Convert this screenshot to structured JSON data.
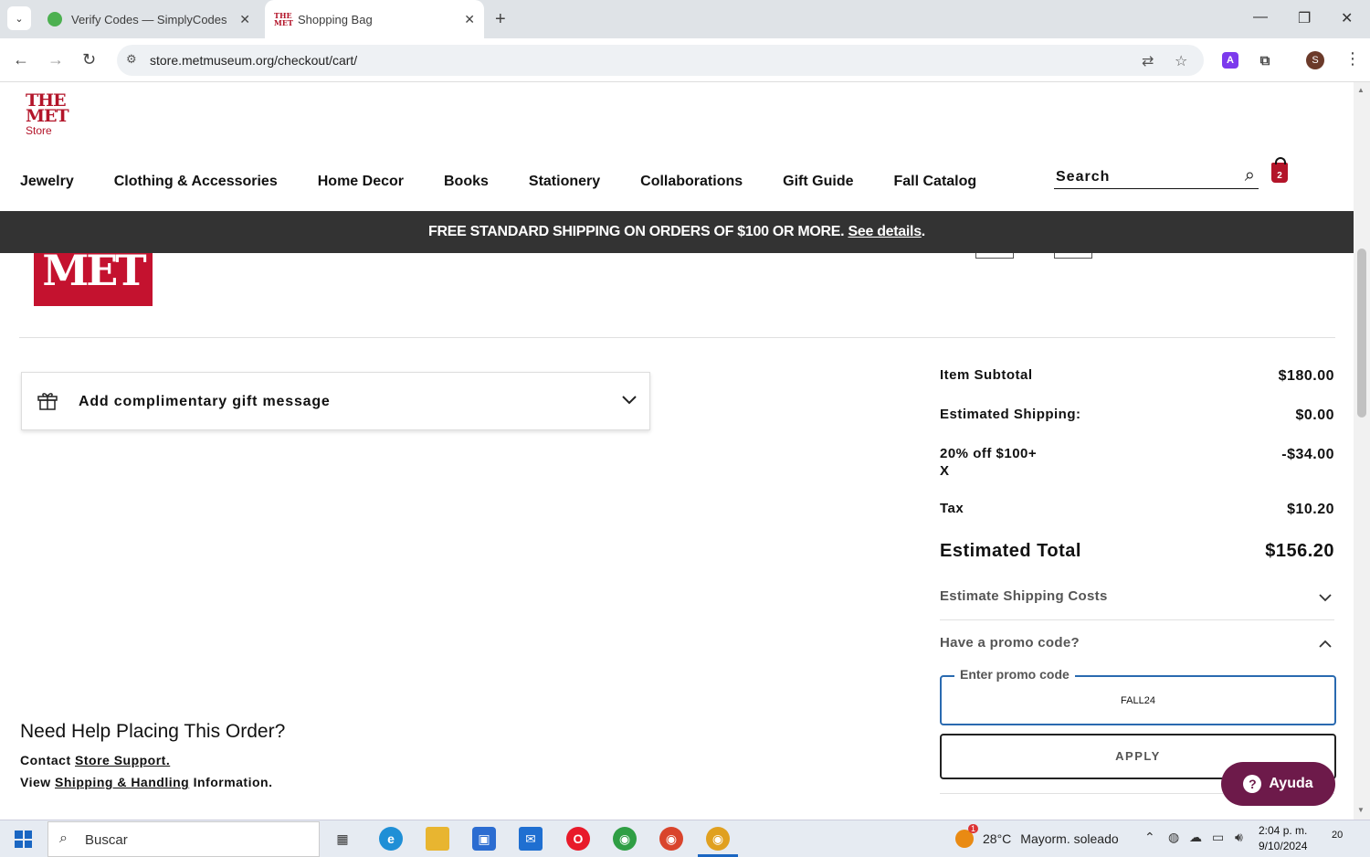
{
  "browser": {
    "tabs": [
      {
        "title": "Verify Codes — SimplyCodes",
        "active": false
      },
      {
        "title": "Shopping Bag",
        "active": true
      }
    ],
    "url": "store.metmuseum.org/checkout/cart/",
    "profile_initial": "S",
    "extension_label": "A"
  },
  "site": {
    "logo": {
      "line1": "THE",
      "line2": "MET",
      "line3": "Store"
    },
    "nav": [
      "Jewelry",
      "Clothing & Accessories",
      "Home Decor",
      "Books",
      "Stationery",
      "Collaborations",
      "Gift Guide",
      "Fall Catalog"
    ],
    "search_placeholder": "Search",
    "bag_count": "2",
    "banner": {
      "text": "FREE STANDARD SHIPPING ON ORDERS OF $100 OR MORE.",
      "link": "See details",
      "suffix": "."
    },
    "product_thumb_text": "MET"
  },
  "gift": {
    "label": "Add complimentary gift message"
  },
  "summary": {
    "rows": [
      {
        "label": "Item Subtotal",
        "value": "$180.00"
      },
      {
        "label": "Estimated Shipping:",
        "value": "$0.00"
      },
      {
        "label": "20% off $100+",
        "sub": "X",
        "value": "-$34.00"
      },
      {
        "label": "Tax",
        "value": "$10.20"
      }
    ],
    "total_label": "Estimated Total",
    "total_value": "$156.20",
    "shipping_estimate_label": "Estimate Shipping Costs",
    "promo_label": "Have a promo code?",
    "promo_field_label": "Enter promo code",
    "promo_value": "FALL24",
    "apply_label": "APPLY"
  },
  "help": {
    "title": "Need Help Placing This Order?",
    "contact_prefix": "Contact",
    "contact_link": "Store Support.",
    "view_prefix": "View",
    "view_link": "Shipping & Handling",
    "view_suffix": "Information."
  },
  "chat": {
    "label": "Ayuda"
  },
  "taskbar": {
    "search_placeholder": "Buscar",
    "weather_temp": "28°C",
    "weather_text": "Mayorm. soleado",
    "weather_alert": "1",
    "time": "2:04 p. m.",
    "date": "9/10/2024",
    "notifications": "20"
  }
}
